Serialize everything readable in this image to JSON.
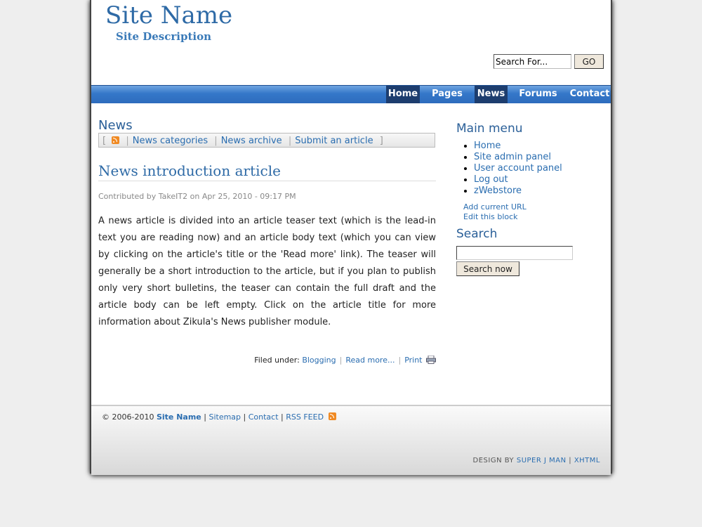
{
  "header": {
    "site_name": "Site Name",
    "site_description": "Site Description",
    "search_placeholder": "Search For...",
    "go_label": "GO"
  },
  "nav": [
    "Home",
    "Pages",
    "News",
    "Forums",
    "Contact"
  ],
  "nav_active": "News",
  "news_block": {
    "title": "News",
    "links": [
      "News categories",
      "News archive",
      "Submit an article"
    ]
  },
  "article": {
    "title": "News introduction article",
    "contributed": "Contributed by TakeIT2 on Apr 25, 2010 - 09:17 PM",
    "body": "A news article is divided into an article teaser text (which is the lead-in text you are reading now) and an article body text (which you can view by clicking on the article's title or the 'Read more' link). The teaser will generally be a short introduction to the article, but if you plan to publish only very short bulletins, the teaser can contain the full draft and the article body can be left empty. Click on the article title for more information about Zikula's News publisher module.",
    "filed_label": "Filed under:",
    "filed_category": "Blogging",
    "read_more": "Read more...",
    "print": "Print"
  },
  "sidebar": {
    "main_menu_title": "Main menu",
    "menu_items": [
      "Home",
      "Site admin panel",
      "User account panel",
      "Log out",
      "zWebstore"
    ],
    "add_url": "Add current URL",
    "edit_block": "Edit this block",
    "search_title": "Search",
    "search_button": "Search now"
  },
  "footer": {
    "copyright": "© 2006-2010",
    "site_name": "Site Name",
    "links": [
      "Sitemap",
      "Contact",
      "RSS FEED"
    ],
    "design_by": "DESIGN BY",
    "designer": "SUPER J MAN",
    "xhtml": "XHTML"
  },
  "colors": {
    "accent": "#2e6aa6",
    "nav_blue": "#3477c9",
    "nav_active": "#1d3d6e",
    "rss_orange": "#f08a24"
  }
}
